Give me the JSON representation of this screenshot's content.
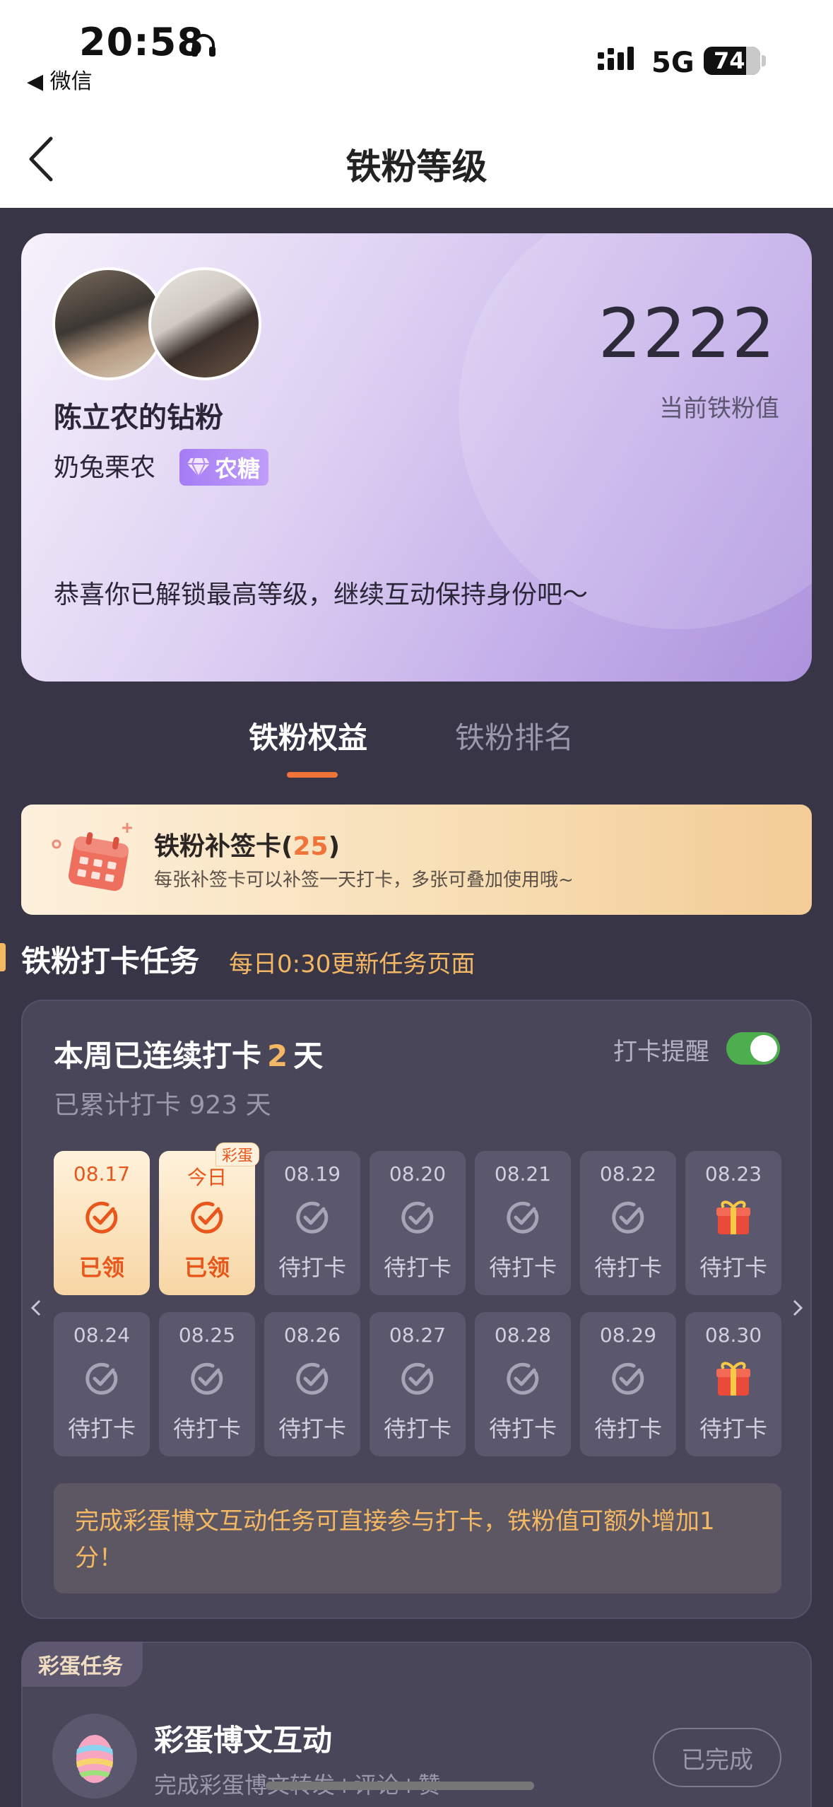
{
  "status_bar": {
    "time": "20:58",
    "back_app": "◀ 微信",
    "network": "5G",
    "battery": "74"
  },
  "header": {
    "title": "铁粉等级"
  },
  "profile": {
    "name": "陈立农的钻粉",
    "nickname": "奶兔栗农",
    "badge": "农糖",
    "score": "2222",
    "score_label": "当前铁粉值",
    "message": "恭喜你已解锁最高等级，继续互动保持身份吧～"
  },
  "tabs": [
    {
      "label": "铁粉权益",
      "active": true
    },
    {
      "label": "铁粉排名",
      "active": false
    }
  ],
  "makeup_card": {
    "title": "铁粉补签卡(",
    "count": "25",
    "title_end": ")",
    "desc": "每张补签卡可以补签一天打卡，多张可叠加使用哦~"
  },
  "section": {
    "title": "铁粉打卡任务",
    "note": "每日0:30更新任务页面"
  },
  "checkin": {
    "streak_prefix": "本周已连续打卡",
    "streak_days": "2",
    "streak_suffix": "天",
    "total": "已累计打卡 923 天",
    "remind_label": "打卡提醒",
    "remind_on": true,
    "days_row1": [
      {
        "date": "08.17",
        "status": "已领",
        "done": true,
        "icon": "check-icon"
      },
      {
        "date": "今日",
        "status": "已领",
        "done": true,
        "icon": "check-icon",
        "tag": "彩蛋"
      },
      {
        "date": "08.19",
        "status": "待打卡",
        "done": false,
        "icon": "check-icon"
      },
      {
        "date": "08.20",
        "status": "待打卡",
        "done": false,
        "icon": "check-icon"
      },
      {
        "date": "08.21",
        "status": "待打卡",
        "done": false,
        "icon": "check-icon"
      },
      {
        "date": "08.22",
        "status": "待打卡",
        "done": false,
        "icon": "check-icon"
      },
      {
        "date": "08.23",
        "status": "待打卡",
        "done": false,
        "icon": "gift-icon"
      }
    ],
    "days_row2": [
      {
        "date": "08.24",
        "status": "待打卡",
        "done": false,
        "icon": "check-icon"
      },
      {
        "date": "08.25",
        "status": "待打卡",
        "done": false,
        "icon": "check-icon"
      },
      {
        "date": "08.26",
        "status": "待打卡",
        "done": false,
        "icon": "check-icon"
      },
      {
        "date": "08.27",
        "status": "待打卡",
        "done": false,
        "icon": "check-icon"
      },
      {
        "date": "08.28",
        "status": "待打卡",
        "done": false,
        "icon": "check-icon"
      },
      {
        "date": "08.29",
        "status": "待打卡",
        "done": false,
        "icon": "check-icon"
      },
      {
        "date": "08.30",
        "status": "待打卡",
        "done": false,
        "icon": "gift-icon"
      }
    ],
    "tip": "完成彩蛋博文互动任务可直接参与打卡，铁粉值可额外增加1分！"
  },
  "egg_task": {
    "tag": "彩蛋任务",
    "title": "彩蛋博文互动",
    "desc": "完成彩蛋博文转发+评论+赞",
    "button": "已完成"
  },
  "colors": {
    "accent": "#f0733a",
    "gold": "#f4b864",
    "page_bg": "#383547",
    "card_bg": "#4a4659",
    "toggle_on": "#4cae4c"
  }
}
